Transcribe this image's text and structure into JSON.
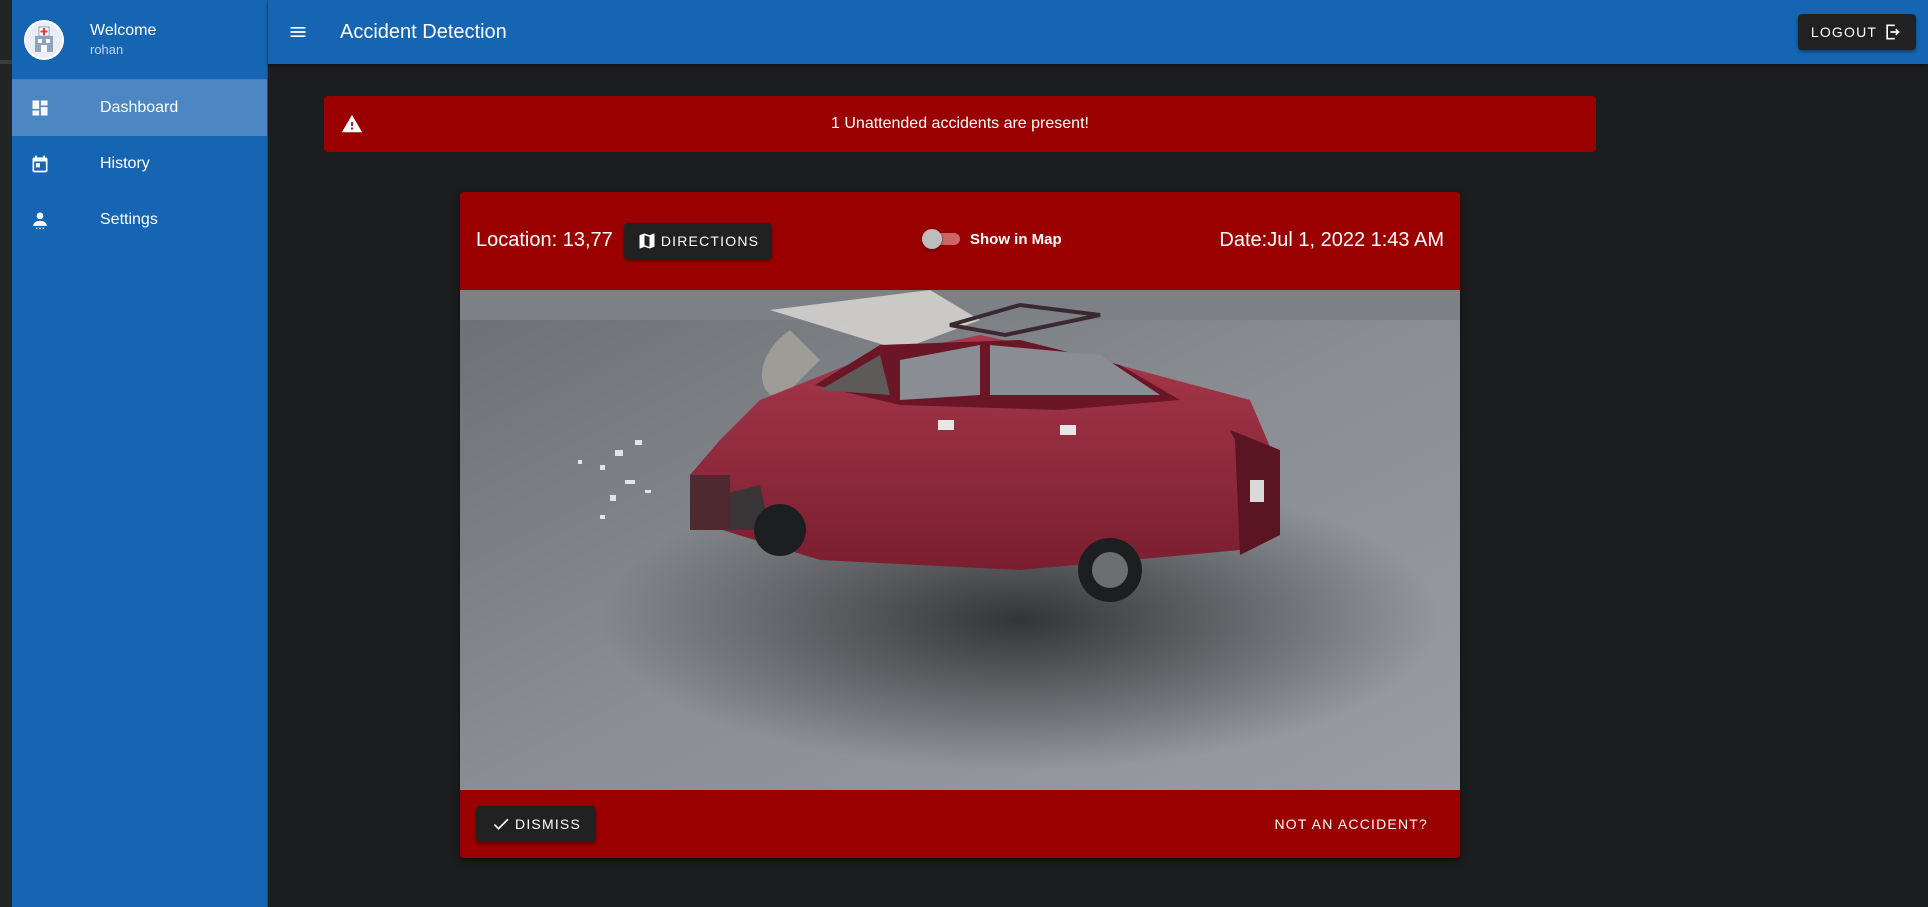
{
  "sidebar": {
    "welcome": "Welcome",
    "username": "rohan",
    "items": [
      {
        "label": "Dashboard",
        "icon": "dashboard-icon",
        "active": true
      },
      {
        "label": "History",
        "icon": "calendar-icon",
        "active": false
      },
      {
        "label": "Settings",
        "icon": "person-icon",
        "active": false
      }
    ]
  },
  "header": {
    "title": "Accident Detection",
    "logout_label": "LOGOUT"
  },
  "alert": {
    "message": "1 Unattended accidents are present!",
    "icon": "warning-icon"
  },
  "accident_card": {
    "location": "Location: 13,77",
    "directions_label": "DIRECTIONS",
    "show_in_map_label": "Show in Map",
    "show_in_map_on": false,
    "date": "Date:Jul 1, 2022 1:43 AM",
    "image": "crashed red sedan on wet road",
    "dismiss_label": "DISMISS",
    "not_accident_label": "NOT AN ACCIDENT?"
  },
  "colors": {
    "primary": "#1565b3",
    "sidebar_active": "#4d87c3",
    "alert_red": "#9b0000",
    "background": "#1c1d1f",
    "button_dark": "#212121"
  }
}
